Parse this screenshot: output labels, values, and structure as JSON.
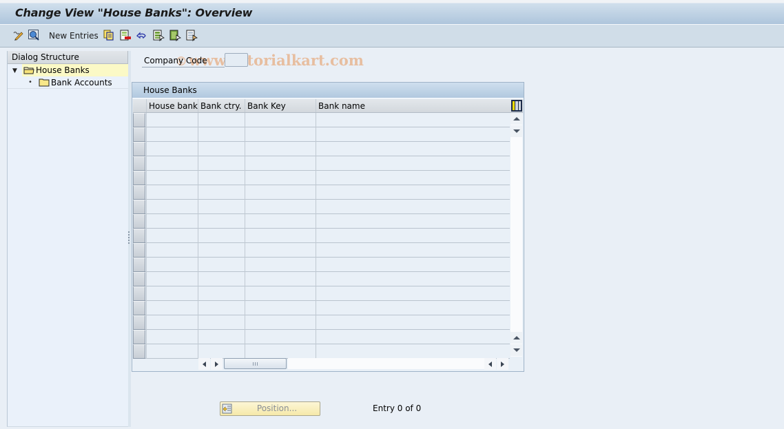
{
  "window": {
    "title": "Change View \"House Banks\": Overview"
  },
  "toolbar": {
    "items": [
      {
        "icon": "display-change-icon",
        "tooltip": "Display -> Change"
      },
      {
        "icon": "find-icon",
        "tooltip": "Find"
      },
      {
        "label": "New Entries"
      },
      {
        "icon": "copy-as-icon"
      },
      {
        "icon": "delete-icon"
      },
      {
        "icon": "undo-change-icon"
      },
      {
        "icon": "select-all-icon"
      },
      {
        "icon": "select-block-icon"
      },
      {
        "icon": "deselect-all-icon"
      }
    ],
    "new_entries_label": "New Entries"
  },
  "watermark": {
    "text": "www.tutorialkart.com"
  },
  "dialog_structure": {
    "header": "Dialog Structure",
    "items": [
      {
        "label": "House Banks",
        "level": 1,
        "expanded": true,
        "selected": true
      },
      {
        "label": "Bank Accounts",
        "level": 2,
        "selected": false
      }
    ]
  },
  "filter": {
    "company_code_label": "Company Code",
    "company_code_value": ""
  },
  "table": {
    "title": "House Banks",
    "columns": [
      "House bank",
      "Bank ctry.",
      "Bank Key",
      "Bank name"
    ],
    "rows": [],
    "visible_empty_rows": 17
  },
  "footer": {
    "position_button_label": "Position...",
    "entry_status": "Entry 0 of 0"
  }
}
